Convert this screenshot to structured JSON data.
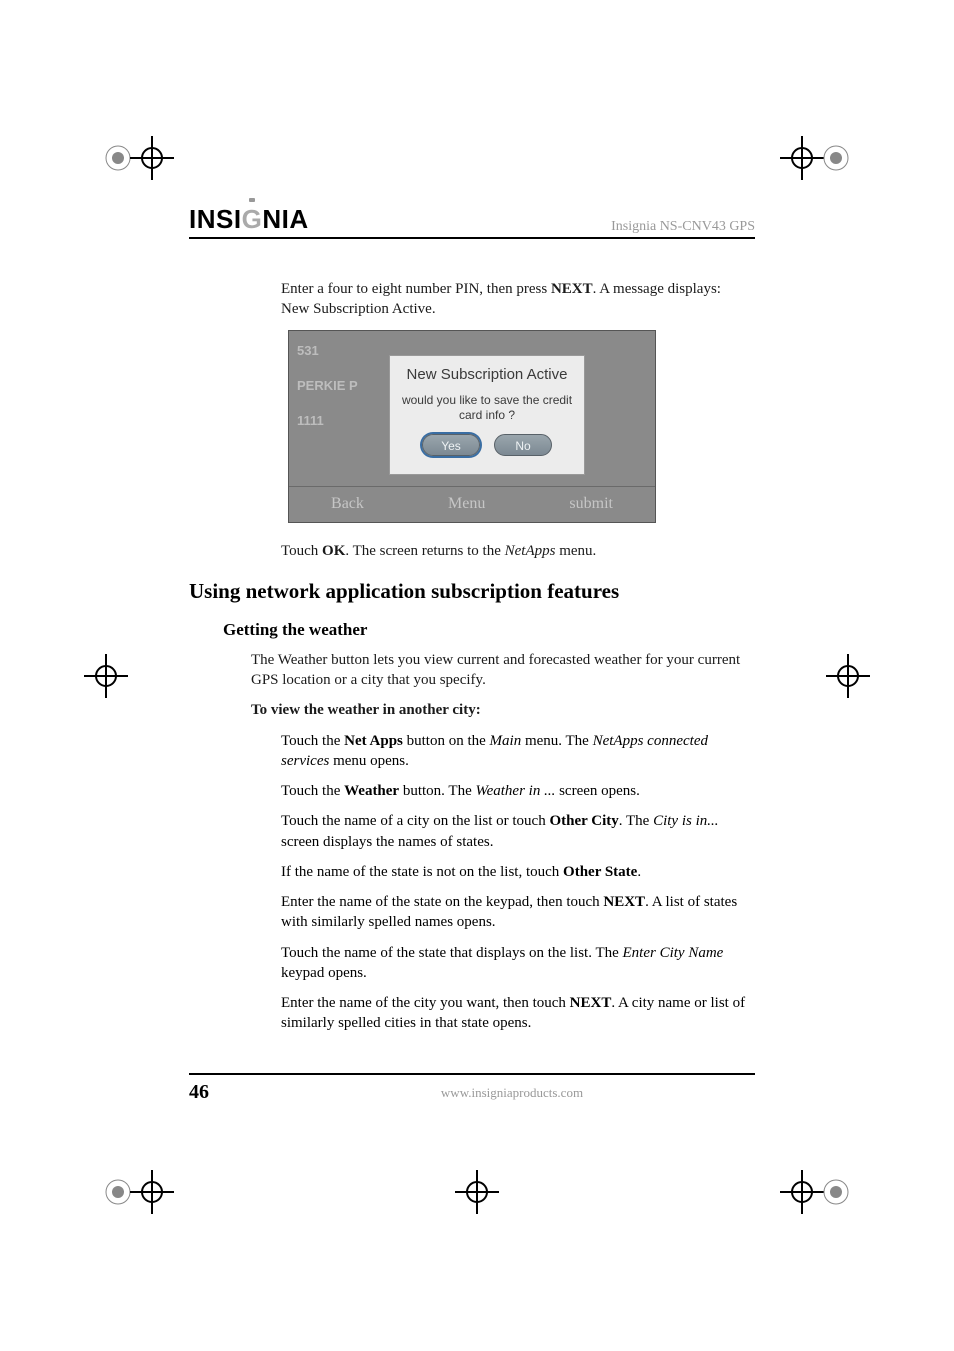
{
  "header": {
    "brand_prefix": "INSI",
    "brand_g": "G",
    "brand_suffix": "NIA",
    "product": "Insignia NS-CNV43 GPS"
  },
  "intro": {
    "line1_a": "Enter a four to eight number PIN, then press ",
    "line1_b": "NEXT",
    "line1_c": ". A message displays: New Subscription Active."
  },
  "screenshot": {
    "list": [
      "531",
      "PERKIE P",
      "1111"
    ],
    "dialog_title": "New Subscription Active",
    "dialog_q": "would you like to save the credit card info ?",
    "yes": "Yes",
    "no": "No",
    "back": "Back",
    "menu": "Menu",
    "submit": "submit"
  },
  "after_shot": {
    "a": "Touch ",
    "b": "OK",
    "c": ". The screen returns to the ",
    "d": "NetApps",
    "e": " menu."
  },
  "section_title": "Using network application subscription features",
  "subsection_title": "Getting the weather",
  "subsection_intro": "The Weather button lets you view current and forecasted weather for your current GPS location or a city that you specify.",
  "procedure_title": "To view the weather in another city:",
  "steps": {
    "s1_a": "Touch the ",
    "s1_b": "Net Apps",
    "s1_c": " button on the ",
    "s1_d": "Main",
    "s1_e": " menu. The ",
    "s1_f": "NetApps connected services",
    "s1_g": " menu opens.",
    "s2_a": "Touch the ",
    "s2_b": "Weather",
    "s2_c": " button. The ",
    "s2_d": "Weather in ...",
    "s2_e": " screen opens.",
    "s3_a": "Touch the name of a city on the list or touch ",
    "s3_b": "Other City",
    "s3_c": ". The ",
    "s3_d": "City is in...",
    "s3_e": " screen displays the names of states.",
    "s4_a": "If the name of the state is not on the list, touch ",
    "s4_b": "Other State",
    "s4_c": ".",
    "s5_a": "Enter the name of the state on the keypad, then touch ",
    "s5_b": "NEXT",
    "s5_c": ". A list of states with similarly spelled names opens.",
    "s6_a": "Touch the name of the state that displays on the list. The ",
    "s6_b": "Enter City Name",
    "s6_c": " keypad opens.",
    "s7_a": "Enter the name of the city you want, then touch ",
    "s7_b": "NEXT",
    "s7_c": ". A city name or list of similarly spelled cities in that state opens."
  },
  "footer": {
    "page": "46",
    "url": "www.insigniaproducts.com"
  }
}
